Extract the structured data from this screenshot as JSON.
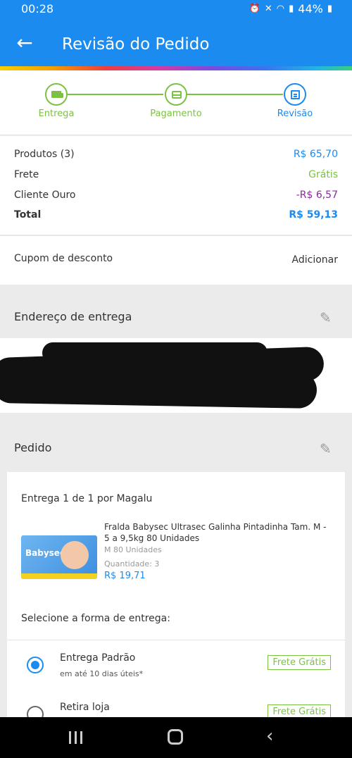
{
  "status": {
    "time": "00:28",
    "battery": "44%"
  },
  "header": {
    "title": "Revisão do Pedido"
  },
  "steps": [
    {
      "label": "Entrega",
      "icon": "truck-icon",
      "state": "done"
    },
    {
      "label": "Pagamento",
      "icon": "credit-card-icon",
      "state": "done"
    },
    {
      "label": "Revisão",
      "icon": "document-icon",
      "state": "active"
    }
  ],
  "summary": {
    "produtos_label": "Produtos (3)",
    "produtos_value": "R$ 65,70",
    "frete_label": "Frete",
    "frete_value": "Grátis",
    "cliente_label": "Cliente Ouro",
    "cliente_value": "-R$ 6,57",
    "total_label": "Total",
    "total_value": "R$ 59,13"
  },
  "cupom": {
    "label": "Cupom de desconto",
    "action": "Adicionar"
  },
  "address": {
    "title": "Endereço de entrega"
  },
  "order": {
    "title": "Pedido",
    "entrega": "Entrega 1 de 1 por Magalu",
    "product_name": "Fralda Babysec Ultrasec Galinha Pintadinha Tam. M - 5 a 9,5kg 80 Unidades",
    "variant": "M 80 Unidades",
    "quantity": "Quantidade: 3",
    "price": "R$ 19,71",
    "thumb_brand": "Babysec",
    "select_label": "Selecione a forma de entrega:",
    "options": [
      {
        "name": "Entrega Padrão",
        "sub": "em até 10 dias úteis*",
        "badge": "Frete Grátis",
        "selected": true
      },
      {
        "name": "Retira loja",
        "sub": "",
        "badge": "Frete Grátis",
        "selected": false
      }
    ]
  },
  "colors": {
    "primary": "#1c8bf0",
    "green": "#7cc242",
    "purple": "#8a2a9a"
  }
}
